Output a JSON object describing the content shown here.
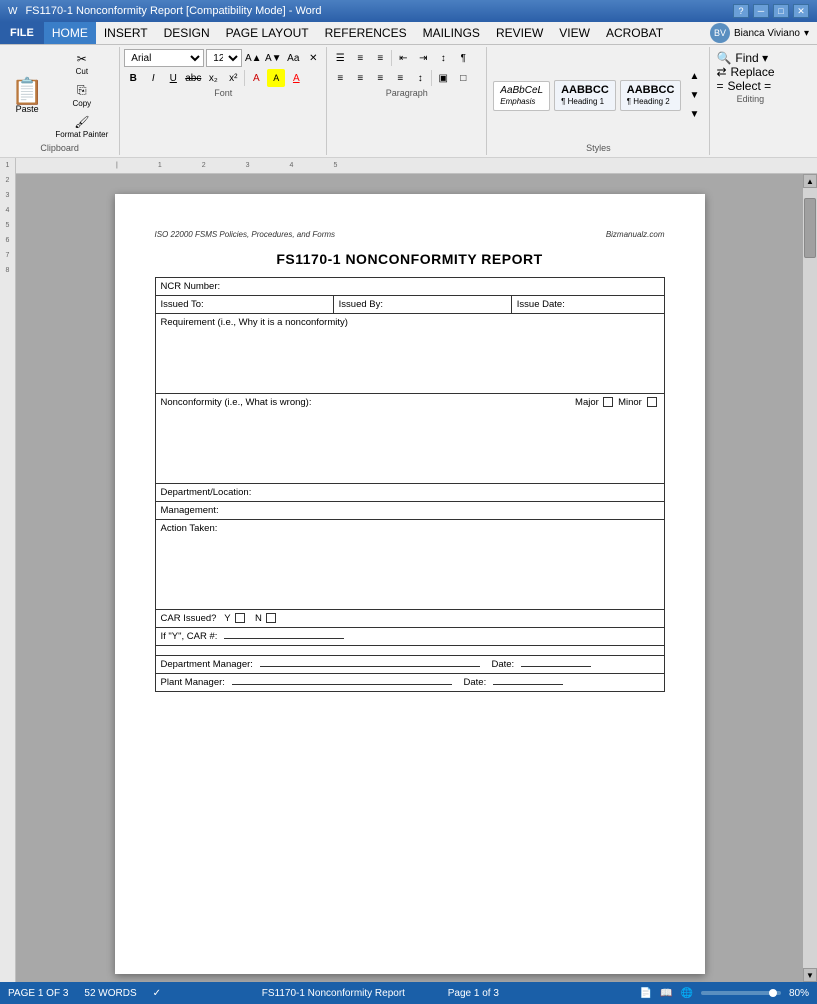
{
  "titleBar": {
    "title": "FS1170-1 Nonconformity Report [Compatibility Mode] - Word",
    "helpIcon": "?",
    "minBtn": "─",
    "maxBtn": "□",
    "closeBtn": "✕"
  },
  "menuBar": {
    "items": [
      "FILE",
      "HOME",
      "INSERT",
      "DESIGN",
      "PAGE LAYOUT",
      "REFERENCES",
      "MAILINGS",
      "REVIEW",
      "VIEW",
      "ACROBAT"
    ]
  },
  "ribbon": {
    "fontName": "Arial",
    "fontSize": "12",
    "user": "Bianca Viviano",
    "sections": {
      "clipboard": "Clipboard",
      "font": "Font",
      "paragraph": "Paragraph",
      "styles": "Styles",
      "editing": "Editing"
    },
    "buttons": {
      "paste": "Paste",
      "cut": "Cut",
      "copy": "Copy",
      "formatPainter": "Format Painter",
      "bold": "B",
      "italic": "I",
      "underline": "U",
      "strikethrough": "abc",
      "subscript": "x₂",
      "superscript": "x²",
      "textColor": "A",
      "highlight": "A",
      "fontGrow": "A",
      "fontShrink": "A",
      "changeCase": "Aa",
      "clearFormatting": "✕",
      "bullets": "≡",
      "numbering": "≡",
      "multilevel": "≡",
      "decreaseIndent": "←",
      "increaseIndent": "→",
      "sort": "↕",
      "showHide": "¶",
      "alignLeft": "≡",
      "center": "≡",
      "alignRight": "≡",
      "justify": "≡",
      "lineSpacing": "↕",
      "shading": "▣",
      "borders": "□",
      "find": "Find ▾",
      "replace": "Replace",
      "select": "Select ="
    },
    "styleChips": [
      {
        "label": "AaBbCeL",
        "name": "Emphasis"
      },
      {
        "label": "AABBCC",
        "name": "¶ Heading 1"
      },
      {
        "label": "AABBCC",
        "name": "¶ Heading 2"
      }
    ]
  },
  "document": {
    "headerLeft": "ISO 22000 FSMS Policies, Procedures, and Forms",
    "headerRight": "Bizmanualz.com",
    "title": "FS1170-1 NONCONFORMITY REPORT",
    "fields": {
      "ncrNumber": "NCR Number:",
      "issuedTo": "Issued To:",
      "issuedBy": "Issued By:",
      "issueDate": "Issue Date:",
      "requirement": "Requirement (i.e., Why it is a nonconformity)",
      "nonconformity": "Nonconformity (i.e., What is wrong):",
      "major": "Major",
      "minor": "Minor",
      "department": "Department/Location:",
      "management": "Management:",
      "actionTaken": "Action Taken:",
      "carIssued": "CAR Issued?",
      "carYes": "Y",
      "carNo": "N",
      "ifYesCar": "If \"Y\", CAR #:",
      "deptManager": "Department Manager:",
      "plantManager": "Plant Manager:",
      "date1": "Date:",
      "date2": "Date:"
    }
  },
  "statusBar": {
    "page": "PAGE 1 OF 3",
    "words": "52 WORDS",
    "docName": "FS1170-1 Nonconformity Report",
    "pageNum": "Page 1 of 3",
    "zoom": "80%"
  }
}
